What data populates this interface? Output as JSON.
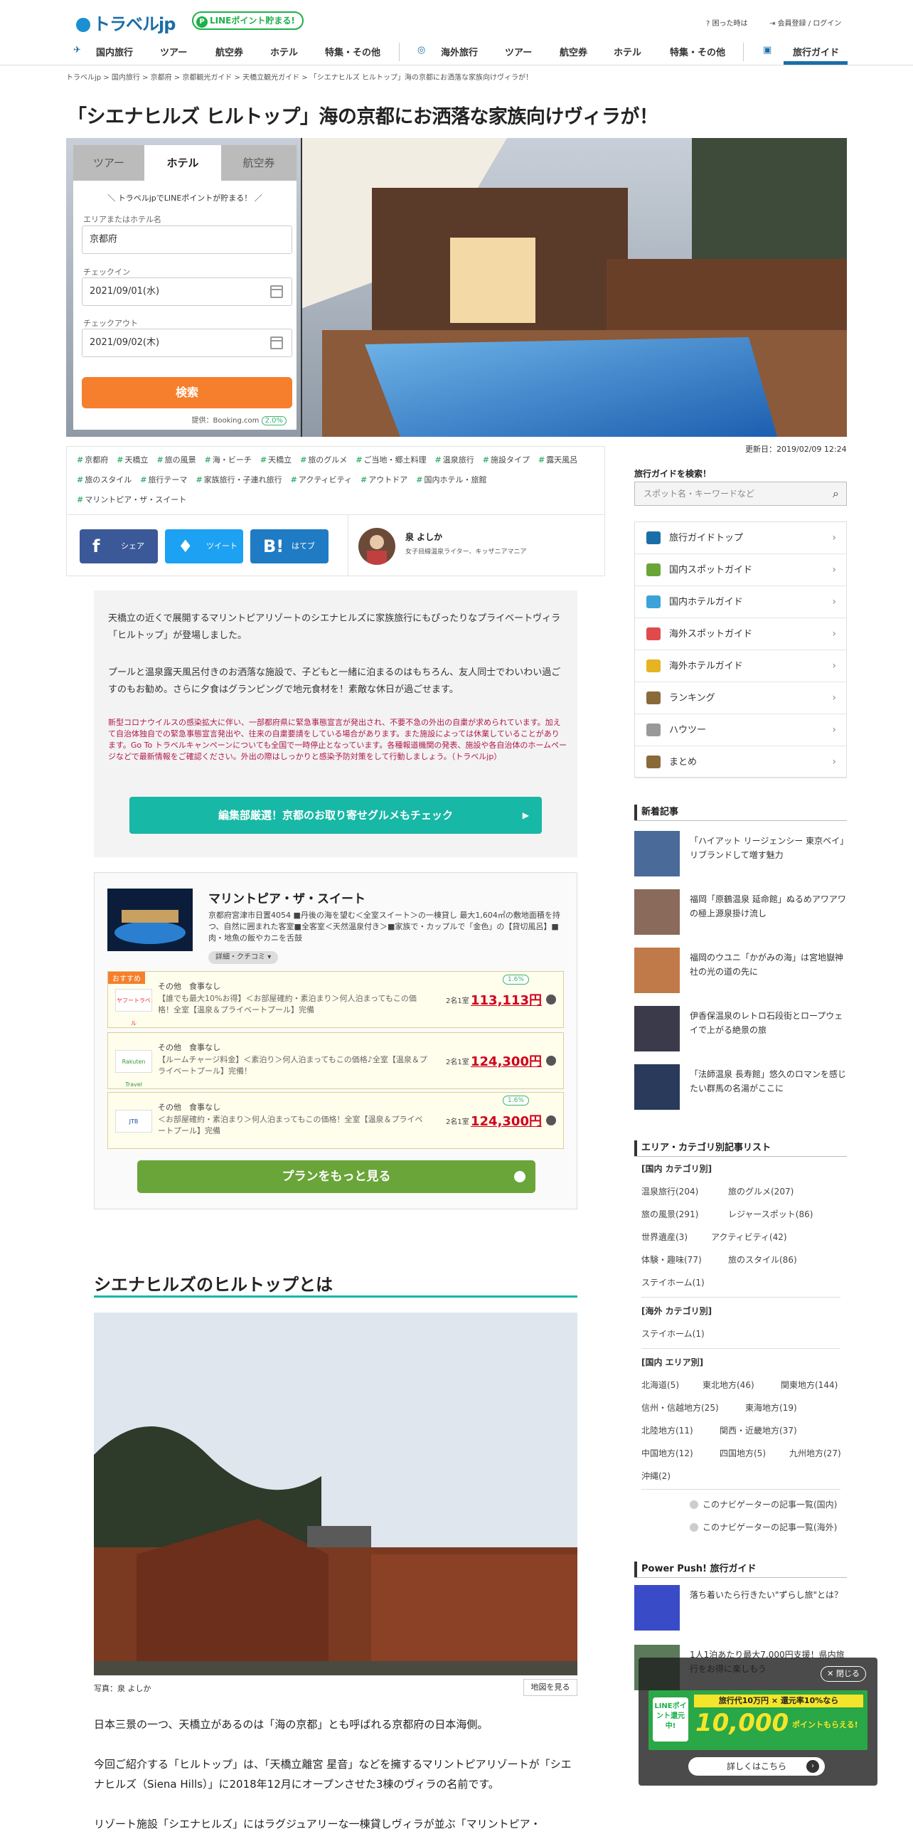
{
  "header": {
    "logo_text": "トラベルjp",
    "line_badge": "LINEポイント貯まる!",
    "help": "困った時は",
    "login": "会員登録 / ログイン",
    "nav": [
      {
        "label": "国内旅行"
      },
      {
        "label": "ツアー"
      },
      {
        "label": "航空券"
      },
      {
        "label": "ホテル"
      },
      {
        "label": "特集・その他"
      },
      {
        "label": "海外旅行"
      },
      {
        "label": "ツアー"
      },
      {
        "label": "航空券"
      },
      {
        "label": "ホテル"
      },
      {
        "label": "特集・その他"
      },
      {
        "label": "旅行ガイド"
      }
    ]
  },
  "breadcrumb": "トラベルjp  >  国内旅行  >  京都府  >  京都観光ガイド  >  天橋立観光ガイド  >  「シエナヒルズ ヒルトップ」海の京都にお洒落な家族向けヴィラが！",
  "article": {
    "title": "「シエナヒルズ ヒルトップ」海の京都にお洒落な家族向けヴィラが！",
    "updated": "更新日：2019/02/09 12:24",
    "tags": [
      "京都府",
      "天橋立",
      "旅の風景",
      "海・ビーチ",
      "天橋立",
      "旅のグルメ",
      "ご当地・郷土料理",
      "温泉旅行",
      "施設タイプ",
      "露天風呂",
      "旅のスタイル",
      "旅行テーマ",
      "家族旅行・子連れ旅行",
      "アクティビティ",
      "アウトドア",
      "国内ホテル・旅館",
      "マリントピア・ザ・スイート"
    ],
    "share": {
      "facebook": "シェア",
      "twitter": "ツイート",
      "hatena": "はてブ"
    },
    "author": {
      "name": "泉 よしか",
      "desc": "女子目線温泉ライター、キッザニアマニア"
    },
    "intro": [
      "天橋立の近くで展開するマリントピアリゾートのシエナヒルズに家族旅行にもぴったりなプライベートヴィラ「ヒルトップ」が登場しました。",
      "プールと温泉露天風呂付きのお洒落な施設で、子どもと一緒に泊まるのはもちろん、友人同士でわいわい過ごすのもお勧め。さらに夕食はグランピングで地元食材を！素敵な休日が過ごせます。"
    ],
    "covid_notice": "新型コロナウイルスの感染拡大に伴い、一部都府県に緊急事態宣言が発出され、不要不急の外出の自粛が求められています。加えて自治体独自での緊急事態宣言発出や、往来の自粛要請をしている場合があります。また施設によっては休業していることがあります。Go To トラベルキャンペーンについても全国で一時停止となっています。各種報道機関の発表、施設や各自治体のホームページなどで最新情報をご確認ください。外出の際はしっかりと感染予防対策をして行動しましょう。（トラベルjp）",
    "gourmet_button": "編集部厳選！京都のお取り寄せグルメもチェック",
    "section_title": "シエナヒルズのヒルトップとは",
    "photo_credit": "写真：泉 よしか",
    "map_button": "地図を見る",
    "body": [
      "日本三景の一つ、天橋立があるのは「海の京都」とも呼ばれる京都府の日本海側。",
      "今回ご紹介する「ヒルトップ」は、「天橋立離宮 星音」などを擁するマリントピアリゾートが「シエナヒルズ（Siena Hills）」に2018年12月にオープンさせた3棟のヴィラの名前です。",
      "リゾート施設「シエナヒルズ」にはラグジュアリーな一棟貸しヴィラが並ぶ「マリントピア・"
    ]
  },
  "search": {
    "tabs": [
      "ツアー",
      "ホテル",
      "航空券"
    ],
    "active_tab": "ホテル",
    "promo": "＼ トラベルjpでLINEポイントが貯まる！ ／",
    "area_label": "エリアまたはホテル名",
    "area_value": "京都府",
    "checkin_label": "チェックイン",
    "checkin_value": "2021/09/01(水)",
    "checkout_label": "チェックアウト",
    "checkout_value": "2021/09/02(木)",
    "submit": "検索",
    "provider": "提供：Booking.com",
    "provider_rate": "2.0%"
  },
  "hotel": {
    "name": "マリントピア・ザ・スイート",
    "desc": "京都府宮津市日置4054 ■丹後の海を望む＜全室スイート＞の一棟貸し 最大1,604㎡の敷地面積を持つ、自然に囲まれた客室■全客室＜天然温泉付き＞■家族で・カップルで「金色」の【貸切風呂】■肉・地魚の飯やカニを舌鼓",
    "detail_label": "詳細・クチコミ",
    "recommend": "おすすめ",
    "plans": [
      {
        "provider": "ヤフートラベル",
        "category": "その他　食事なし",
        "text": "【誰でも最大10%お得】＜お部屋確約・素泊まり＞何人泊まってもこの価格！全室【温泉＆プライベートプール】完備",
        "per": "2名1室",
        "price": "113,113円",
        "rate": "1.6%"
      },
      {
        "provider": "Rakuten Travel",
        "category": "その他　食事なし",
        "text": "【ルームチャージ料金】＜素泊り＞何人泊まってもこの価格♪全室【温泉＆プライベートプール】完備！",
        "per": "2名1室",
        "price": "124,300円",
        "rate": ""
      },
      {
        "provider": "JTB",
        "category": "その他　食事なし",
        "text": "＜お部屋確約・素泊まり＞何人泊まってもこの価格！全室【温泉＆プライベートプール】完備",
        "per": "2名1室",
        "price": "124,300円",
        "rate": "1.6%"
      }
    ],
    "more_plans": "プランをもっと見る"
  },
  "sidebar": {
    "search_title": "旅行ガイドを検索！",
    "search_placeholder": "スポット名・キーワードなど",
    "menu": [
      {
        "label": "旅行ガイドトップ",
        "color": "#1a6ea8"
      },
      {
        "label": "国内スポットガイド",
        "color": "#6aa53a"
      },
      {
        "label": "国内ホテルガイド",
        "color": "#3ba3d8"
      },
      {
        "label": "海外スポットガイド",
        "color": "#e04a4a"
      },
      {
        "label": "海外ホテルガイド",
        "color": "#e6b422"
      },
      {
        "label": "ランキング",
        "color": "#8a6a3a"
      },
      {
        "label": "ハウツー",
        "color": "#999999"
      },
      {
        "label": "まとめ",
        "color": "#8a6a3a"
      }
    ],
    "new_title": "新着記事",
    "new_articles": [
      "「ハイアット リージェンシー 東京ベイ」リブランドして増す魅力",
      "福岡「原鶴温泉 延命館」ぬるめアワアワの極上源泉掛け流し",
      "福岡のウユニ「かがみの海」は宮地嶽神社の光の道の先に",
      "伊香保温泉のレトロ石段街とロープウェイで上がる絶景の旅",
      "「法師温泉 長寿館」悠久のロマンを感じたい群馬の名湯がここに"
    ],
    "area_title": "エリア・カテゴリ別記事リスト",
    "domestic_cat_title": "[国内 カテゴリ別]",
    "domestic_cats": [
      [
        "温泉旅行(204)",
        "旅のグルメ(207)"
      ],
      [
        "旅の風景(291)",
        "レジャースポット(86)"
      ],
      [
        "世界遺産(3)",
        "アクティビティ(42)"
      ],
      [
        "体験・趣味(77)",
        "旅のスタイル(86)"
      ],
      [
        "ステイホーム(1)"
      ]
    ],
    "overseas_cat_title": "[海外 カテゴリ別]",
    "overseas_cats": [
      "ステイホーム(1)"
    ],
    "domestic_area_title": "[国内 エリア別]",
    "domestic_areas": [
      [
        "北海道(5)",
        "東北地方(46)",
        "関東地方(144)"
      ],
      [
        "信州・信越地方(25)",
        "東海地方(19)"
      ],
      [
        "北陸地方(11)",
        "関西・近畿地方(37)"
      ],
      [
        "中国地方(12)",
        "四国地方(5)",
        "九州地方(27)"
      ],
      [
        "沖縄(2)"
      ]
    ],
    "nav_links": [
      "このナビゲーターの記事一覧(国内)",
      "このナビゲーターの記事一覧(海外)"
    ],
    "powerpush_title": "Power Push! 旅行ガイド",
    "powerpush": [
      "落ち着いたら行きたい\"ずらし旅\"とは？",
      "1人1泊あたり最大7,000円支援！県内旅行をお得に楽しもう"
    ]
  },
  "popup": {
    "close": "閉じる",
    "banner_line1": "旅行代10万円 × 還元率10%なら",
    "banner_big": "10,000",
    "banner_tail": "ポイントもらえる!",
    "banner_badge": "LINEポイント還元中!",
    "detail": "詳しくはこちら"
  }
}
